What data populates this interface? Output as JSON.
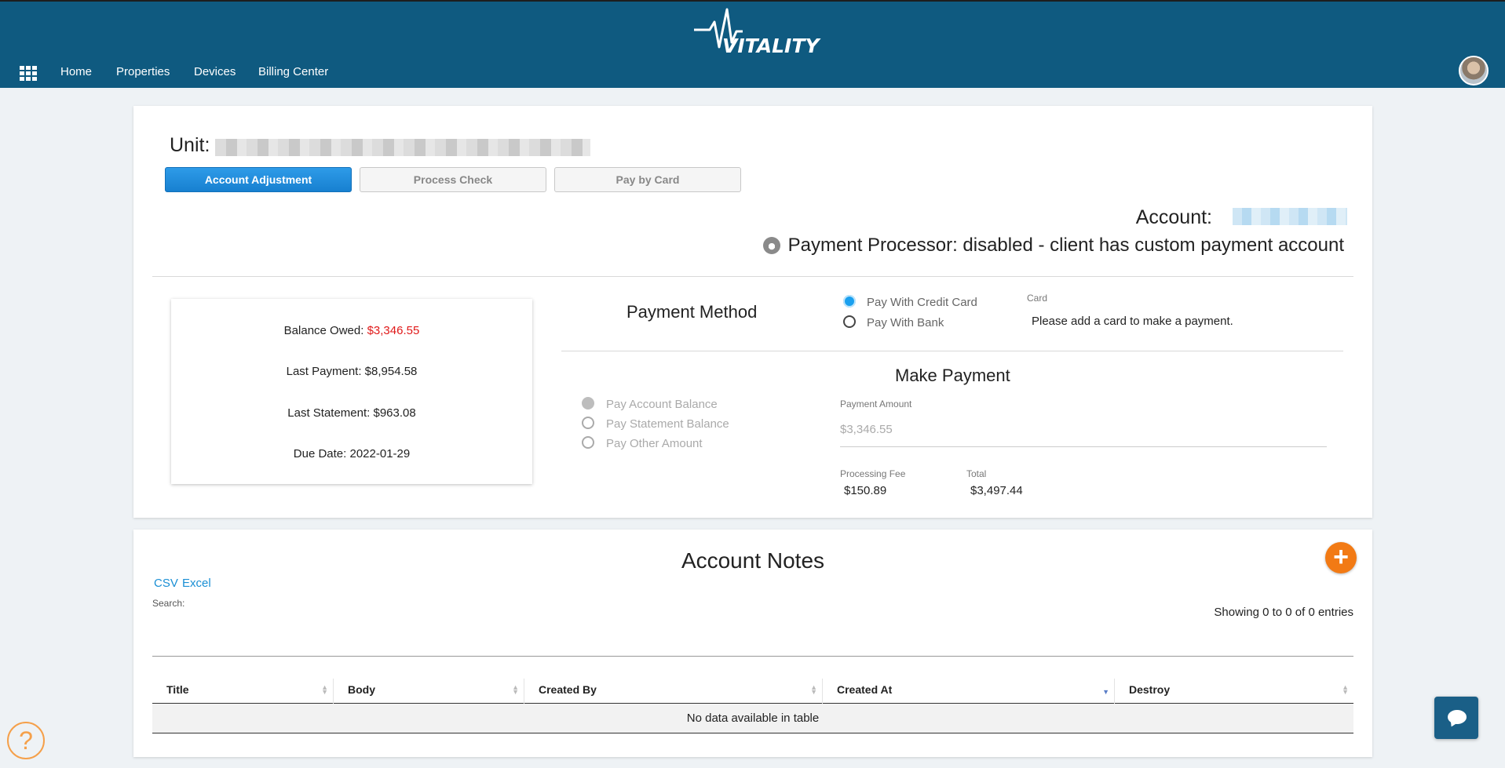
{
  "header": {
    "logo_text": "VITALITY",
    "nav": [
      "Home",
      "Properties",
      "Devices",
      "Billing Center"
    ]
  },
  "unit": {
    "label": "Unit:"
  },
  "actions": {
    "account_adjustment": "Account Adjustment",
    "process_check": "Process Check",
    "pay_by_card": "Pay by Card"
  },
  "account": {
    "label": "Account:",
    "processor": "Payment Processor: disabled - client has custom payment account"
  },
  "balance": {
    "owed_label": "Balance Owed:",
    "owed_value": "$3,346.55",
    "last_payment": "Last Payment: $8,954.58",
    "last_statement": "Last Statement: $963.08",
    "due_date": "Due Date: 2022-01-29"
  },
  "payment_method": {
    "title": "Payment Method",
    "options": [
      "Pay With Credit Card",
      "Pay With Bank"
    ],
    "card_label": "Card",
    "card_message": "Please add a card to make a payment."
  },
  "make_payment": {
    "title": "Make Payment",
    "options": [
      "Pay Account Balance",
      "Pay Statement Balance",
      "Pay Other Amount"
    ],
    "amount_label": "Payment Amount",
    "amount_value": "$3,346.55",
    "fee_label": "Processing Fee",
    "fee_value": "$150.89",
    "total_label": "Total",
    "total_value": "$3,497.44"
  },
  "notes": {
    "title": "Account Notes",
    "add_symbol": "+",
    "exports": [
      "CSV",
      "Excel"
    ],
    "search_label": "Search:",
    "showing": "Showing 0 to 0 of 0 entries",
    "columns": [
      "Title",
      "Body",
      "Created By",
      "Created At",
      "Destroy"
    ],
    "empty": "No data available in table"
  },
  "help": {
    "symbol": "?"
  },
  "colors": {
    "header": "#0f5a80",
    "primary": "#1a8fd4",
    "accent": "#f27a14",
    "danger": "#e01818"
  }
}
